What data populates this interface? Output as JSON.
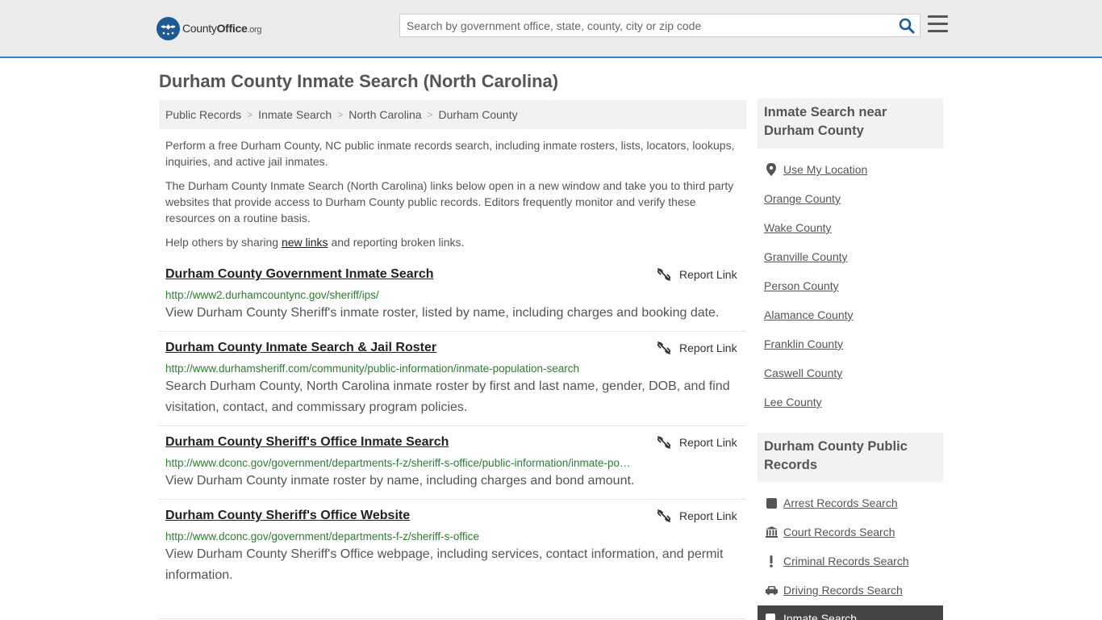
{
  "header": {
    "logo": {
      "brand_regular": "County",
      "brand_bold": "Office",
      "tld": ".org"
    },
    "search": {
      "placeholder": "Search by government office, state, county, city or zip code",
      "value": ""
    },
    "icons": {
      "search": "search-icon",
      "menu": "hamburger-menu-icon"
    }
  },
  "page": {
    "title": "Durham County Inmate Search (North Carolina)"
  },
  "breadcrumb": [
    "Public Records",
    "Inmate Search",
    "North Carolina",
    "Durham County"
  ],
  "intro": {
    "p1": "Perform a free Durham County, NC public inmate records search, including inmate rosters, lists, locators, lookups, inquiries, and active jail inmates.",
    "p2": "The Durham County Inmate Search (North Carolina) links below open in a new window and take you to third party websites that provide access to Durham County public records. Editors frequently monitor and verify these resources on a routine basis.",
    "p3_before": "Help others by sharing ",
    "p3_link": "new links",
    "p3_after": " and reporting broken links."
  },
  "report_label": "Report Link",
  "results": [
    {
      "title": "Durham County Government Inmate Search",
      "url": "http://www2.durhamcountync.gov/sheriff/ips/",
      "description": "View Durham County Sheriff's inmate roster, listed by name, including charges and booking date."
    },
    {
      "title": "Durham County Inmate Search & Jail Roster",
      "url": "http://www.durhamsheriff.com/community/public-information/inmate-population-search",
      "description": "Search Durham County, North Carolina inmate roster by first and last name, gender, DOB, and find visitation, contact, and commissary program policies."
    },
    {
      "title": "Durham County Sheriff's Office Inmate Search",
      "url": "http://www.dconc.gov/government/departments-f-z/sheriff-s-office/public-information/inmate-population-search",
      "description": "View Durham County inmate roster by name, including charges and bond amount."
    },
    {
      "title": "Durham County Sheriff's Office Website",
      "url": "http://www.dconc.gov/government/departments-f-z/sheriff-s-office",
      "description": "View Durham County Sheriff's Office webpage, including services, contact information, and permit information."
    }
  ],
  "sidebar": {
    "nearby_heading": "Inmate Search near Durham County",
    "use_location": "Use My Location",
    "nearby": [
      "Orange County",
      "Wake County",
      "Granville County",
      "Person County",
      "Alamance County",
      "Franklin County",
      "Caswell County",
      "Lee County"
    ],
    "records_heading": "Durham County Public Records",
    "records": [
      {
        "label": "Arrest Records Search",
        "icon": "square-icon"
      },
      {
        "label": "Court Records Search",
        "icon": "courthouse-icon"
      },
      {
        "label": "Criminal Records Search",
        "icon": "exclamation-icon"
      },
      {
        "label": "Driving Records Search",
        "icon": "car-icon"
      }
    ],
    "active_item": "Inmate Search"
  },
  "colors": {
    "header_bg": "#ececec",
    "header_border": "#3a7fc3",
    "logo_blue": "#1d5a96",
    "url_green": "#2e7d32",
    "panel_bg": "#f2f2f2",
    "active_bg": "#444444"
  }
}
